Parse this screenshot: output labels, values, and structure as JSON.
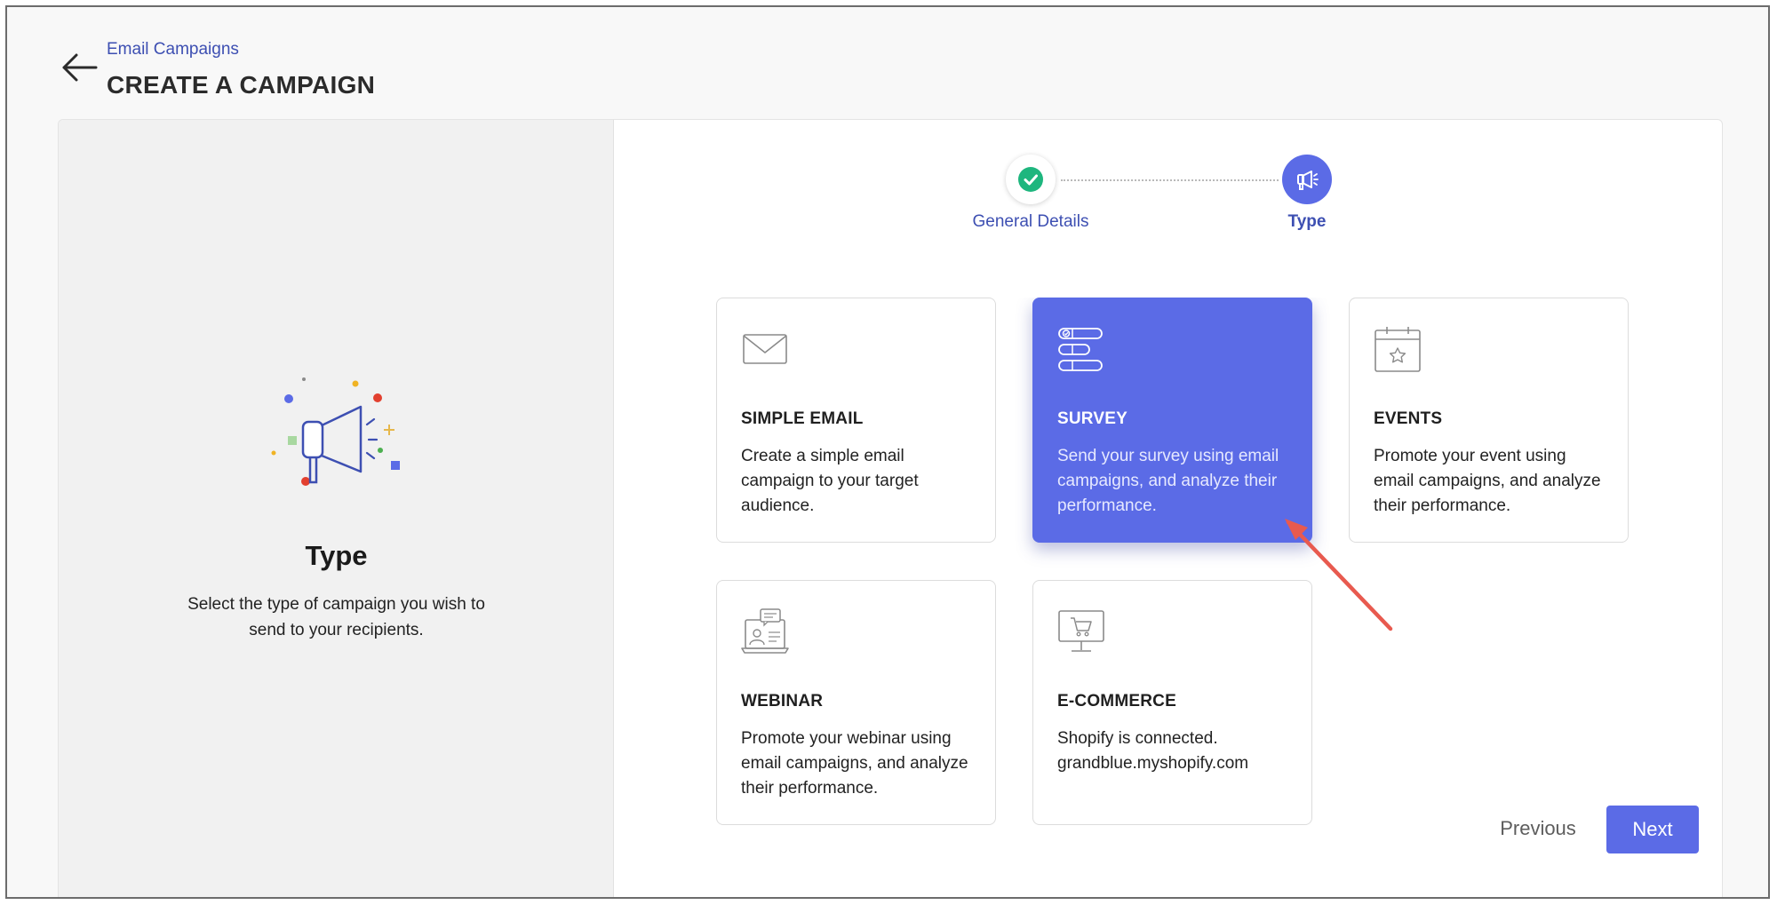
{
  "header": {
    "breadcrumb": "Email Campaigns",
    "title": "CREATE A CAMPAIGN"
  },
  "left_pane": {
    "title": "Type",
    "description": "Select the type of campaign you wish to send to your recipients."
  },
  "stepper": {
    "steps": [
      {
        "label": "General Details",
        "status": "completed",
        "icon": "check-icon"
      },
      {
        "label": "Type",
        "status": "active",
        "icon": "megaphone-icon"
      }
    ]
  },
  "cards": [
    {
      "title": "SIMPLE EMAIL",
      "description": "Create a simple email campaign to your target audience.",
      "icon": "envelope-icon",
      "selected": false
    },
    {
      "title": "SURVEY",
      "description": "Send your survey using email campaigns, and analyze their performance.",
      "icon": "survey-icon",
      "selected": true
    },
    {
      "title": "EVENTS",
      "description": "Promote your event using email campaigns, and analyze their performance.",
      "icon": "calendar-star-icon",
      "selected": false
    },
    {
      "title": "WEBINAR",
      "description": "Promote your webinar using email campaigns, and analyze their performance.",
      "icon": "webinar-icon",
      "selected": false
    },
    {
      "title": "E-COMMERCE",
      "description": "Shopify is connected. grandblue.myshopify.com",
      "icon": "monitor-cart-icon",
      "selected": false
    }
  ],
  "footer": {
    "previous_label": "Previous",
    "next_label": "Next"
  },
  "colors": {
    "accent": "#5b6be6",
    "link": "#3d4fb2",
    "success": "#1eb67e",
    "annotation_arrow": "#e85a4f"
  }
}
